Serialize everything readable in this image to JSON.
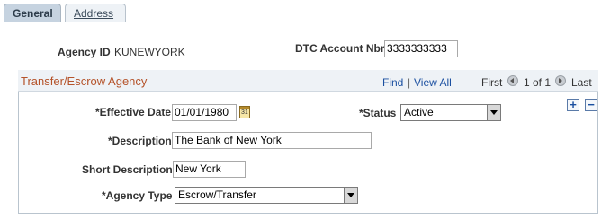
{
  "tabs": [
    {
      "label": "General",
      "active": true
    },
    {
      "label": "Address",
      "active": false
    }
  ],
  "header": {
    "agency_id_label": "Agency ID",
    "agency_id_value": "KUNEWYORK",
    "dtc_label": "DTC Account Nbr",
    "dtc_value": "3333333333"
  },
  "group": {
    "title": "Transfer/Escrow Agency",
    "find": "Find",
    "separator": "|",
    "view_all": "View All",
    "first": "First",
    "pager": "1 of 1",
    "last": "Last",
    "add_icon": "plus-icon",
    "remove_icon": "minus-icon"
  },
  "form": {
    "effective_date_label": "*Effective Date",
    "effective_date_value": "01/01/1980",
    "calendar_icon_text": "31",
    "status_label": "*Status",
    "status_value": "Active",
    "description_label": "*Description",
    "description_value": "The Bank of New York",
    "short_description_label": "Short Description",
    "short_description_value": "New York",
    "agency_type_label": "*Agency Type",
    "agency_type_value": "Escrow/Transfer"
  },
  "colors": {
    "group_title": "#b5532a",
    "link": "#1a4fa0",
    "tab_active_bg": "#c6d3e0"
  }
}
